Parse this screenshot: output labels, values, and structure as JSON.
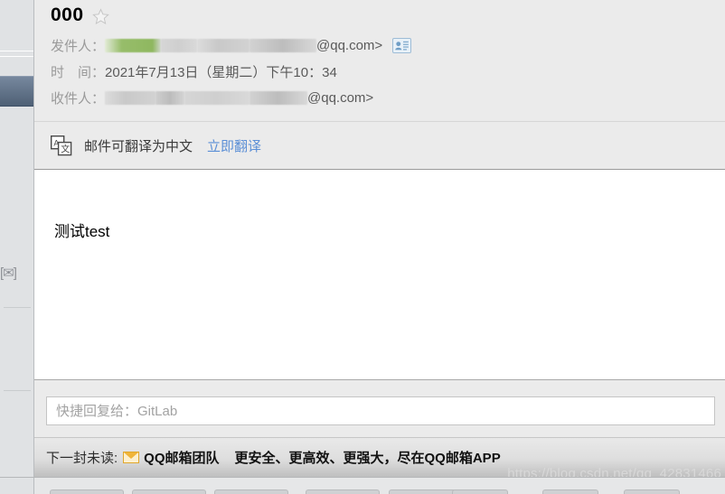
{
  "window": {
    "watermark": "https://blog.csdn.net/qq_42831466"
  },
  "sidebar": {
    "clip_glyph": "[✉]"
  },
  "mail": {
    "subject": "000",
    "star_icon": "star-outline-icon",
    "from": {
      "label": "发件人：",
      "redacted": true,
      "value_suffix": "@qq.com>",
      "contact_icon": "contact-card-icon"
    },
    "date": {
      "label": "时　间：",
      "value": "2021年7月13日（星期二）下午10：34"
    },
    "to": {
      "label": "收件人：",
      "redacted": true,
      "value_suffix": "@qq.com>"
    },
    "translate": {
      "icon": "translate-icon",
      "text": "邮件可翻译为中文",
      "link": "立即翻译"
    },
    "body_text": "测试test"
  },
  "quick_reply": {
    "placeholder": "快捷回复给：GitLab",
    "value": ""
  },
  "next_unread": {
    "label": "下一封未读:",
    "envelope_icon": "envelope-icon",
    "sender": "QQ邮箱团队",
    "subject": "更安全、更高效、更强大，尽在QQ邮箱APP"
  },
  "colors": {
    "header_bg": "#ebebeb",
    "link": "#5b8fd6",
    "selected_item": "#4e6075",
    "envelope": "#f0b53a"
  }
}
